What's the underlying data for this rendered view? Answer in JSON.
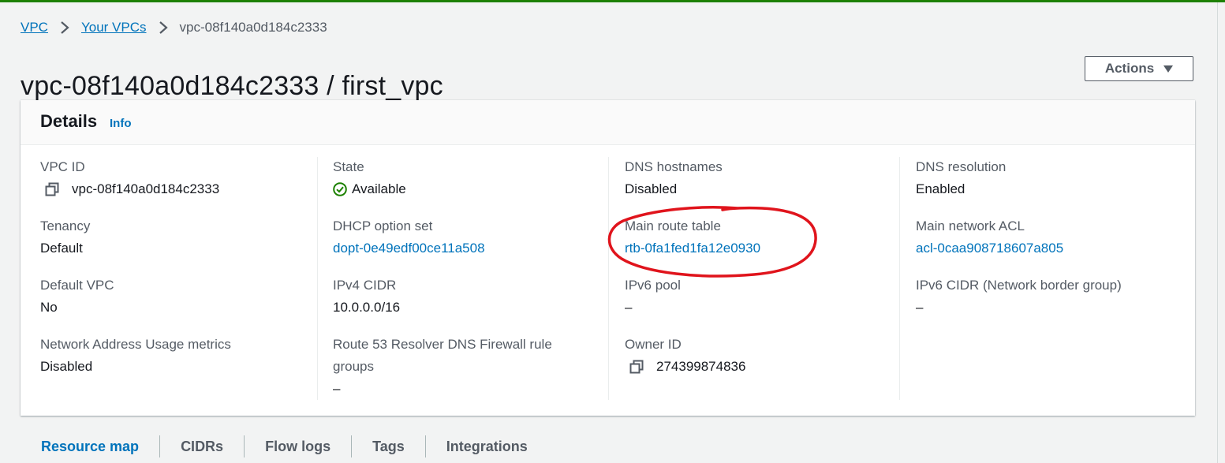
{
  "breadcrumb": {
    "root": "VPC",
    "parent": "Your VPCs",
    "current": "vpc-08f140a0d184c2333"
  },
  "page_title": "vpc-08f140a0d184c2333 / first_vpc",
  "actions": {
    "label": "Actions"
  },
  "details": {
    "title": "Details",
    "info": "Info",
    "col1": {
      "vpc_id": {
        "label": "VPC ID",
        "value": "vpc-08f140a0d184c2333"
      },
      "tenancy": {
        "label": "Tenancy",
        "value": "Default"
      },
      "default_vpc": {
        "label": "Default VPC",
        "value": "No"
      },
      "nau_metrics": {
        "label": "Network Address Usage metrics",
        "value": "Disabled"
      }
    },
    "col2": {
      "state": {
        "label": "State",
        "value": "Available"
      },
      "dhcp": {
        "label": "DHCP option set",
        "value": "dopt-0e49edf00ce11a508"
      },
      "ipv4": {
        "label": "IPv4 CIDR",
        "value": "10.0.0.0/16"
      },
      "r53_line1": "Route 53 Resolver DNS Firewall rule",
      "r53_line2": "groups",
      "r53_value": "–"
    },
    "col3": {
      "dns_hostnames": {
        "label": "DNS hostnames",
        "value": "Disabled"
      },
      "main_route_table": {
        "label": "Main route table",
        "value": "rtb-0fa1fed1fa12e0930"
      },
      "ipv6_pool": {
        "label": "IPv6 pool",
        "value": "–"
      },
      "owner_id": {
        "label": "Owner ID",
        "value": "274399874836"
      }
    },
    "col4": {
      "dns_resolution": {
        "label": "DNS resolution",
        "value": "Enabled"
      },
      "main_acl": {
        "label": "Main network ACL",
        "value": "acl-0caa908718607a805"
      },
      "ipv6_cidr": {
        "label": "IPv6 CIDR (Network border group)",
        "value": "–"
      }
    }
  },
  "tabs": [
    "Resource map",
    "CIDRs",
    "Flow logs",
    "Tags",
    "Integrations"
  ],
  "colors": {
    "link": "#0073bb",
    "success": "#1d8102",
    "annotation": "#e0141c"
  }
}
